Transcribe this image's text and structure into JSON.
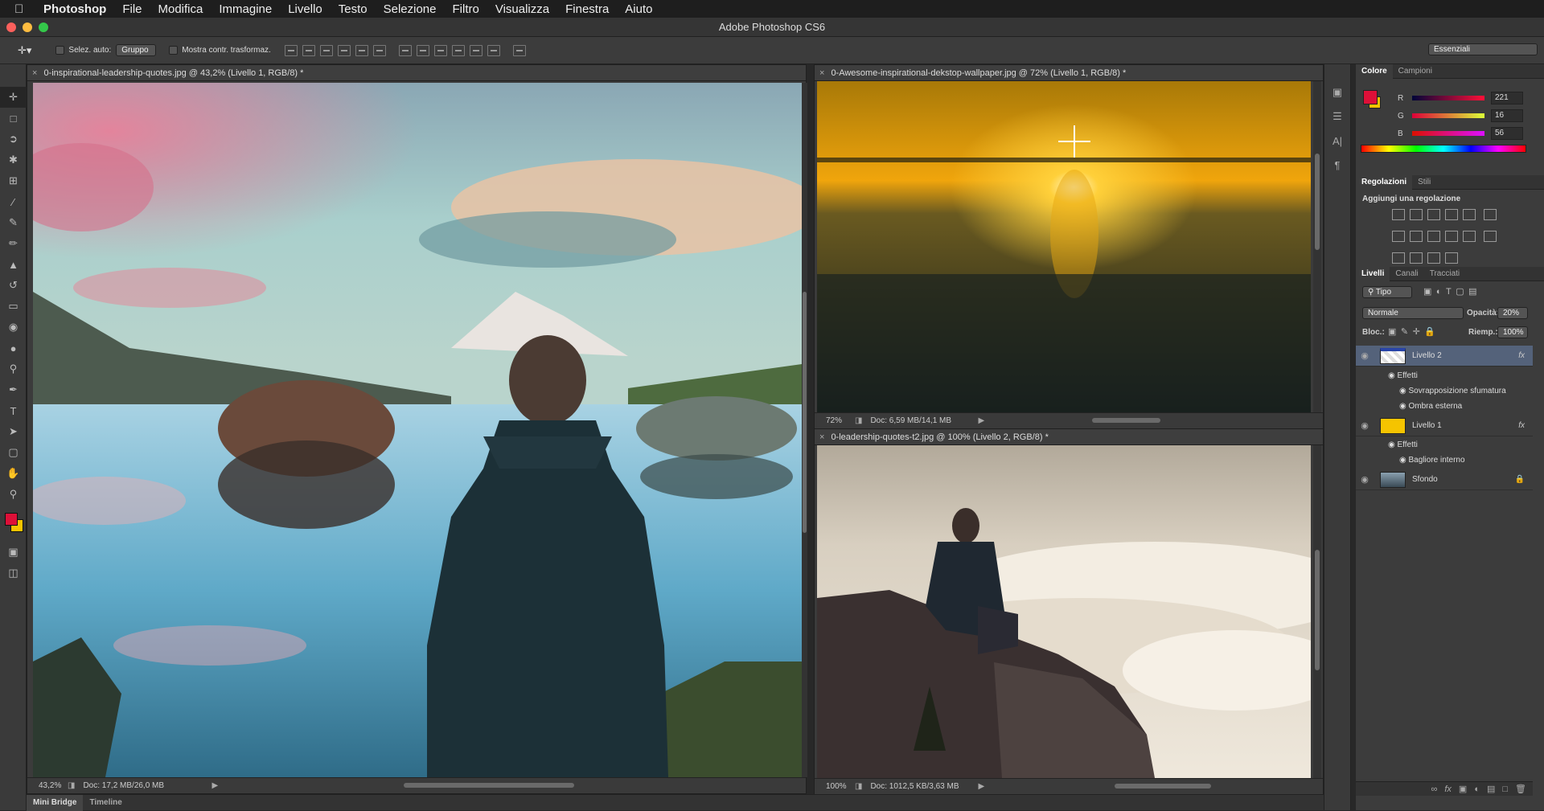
{
  "menubar": {
    "app_name": "Photoshop",
    "items": [
      "File",
      "Modifica",
      "Immagine",
      "Livello",
      "Testo",
      "Selezione",
      "Filtro",
      "Visualizza",
      "Finestra",
      "Aiuto"
    ]
  },
  "window": {
    "title": "Adobe Photoshop CS6"
  },
  "options": {
    "auto_select_label": "Selez. auto:",
    "auto_select_value": "Gruppo",
    "transform_label": "Mostra contr. trasformaz.",
    "workspace": "Essenziali"
  },
  "documents": [
    {
      "title": "0-inspirational-leadership-quotes.jpg @ 43,2% (Livello 1, RGB/8) *",
      "zoom": "43,2%",
      "doc_size": "Doc: 17,2 MB/26,0 MB"
    },
    {
      "title": "0-Awesome-inspirational-dekstop-wallpaper.jpg @ 72% (Livello 1, RGB/8) *",
      "zoom": "72%",
      "doc_size": "Doc: 6,59 MB/14,1 MB"
    },
    {
      "title": "0-leadership-quotes-t2.jpg @ 100% (Livello 2, RGB/8) *",
      "zoom": "100%",
      "doc_size": "Doc: 1012,5 KB/3,63 MB"
    }
  ],
  "bottom_tabs": [
    "Mini Bridge",
    "Timeline"
  ],
  "color_panel": {
    "tabs": [
      "Colore",
      "Campioni"
    ],
    "foreground": "#dd1038",
    "background": "#f5c400",
    "r_label": "R",
    "r": "221",
    "g_label": "G",
    "g": "16",
    "b_label": "B",
    "b": "56"
  },
  "adjustments_panel": {
    "tabs": [
      "Regolazioni",
      "Stili"
    ],
    "heading": "Aggiungi una regolazione"
  },
  "layers_panel": {
    "tabs": [
      "Livelli",
      "Canali",
      "Tracciati"
    ],
    "filter": "Tipo",
    "blend_mode": "Normale",
    "opacity_label": "Opacità:",
    "opacity": "20%",
    "lock_label": "Bloc.:",
    "fill_label": "Riemp.:",
    "fill": "100%",
    "layers": [
      {
        "name": "Livello 2",
        "effects_label": "Effetti",
        "effects": [
          "Sovrapposizione sfumatura",
          "Ombra esterna"
        ]
      },
      {
        "name": "Livello 1",
        "effects_label": "Effetti",
        "effects": [
          "Bagliore interno"
        ]
      },
      {
        "name": "Sfondo"
      }
    ],
    "fx": "fx"
  }
}
